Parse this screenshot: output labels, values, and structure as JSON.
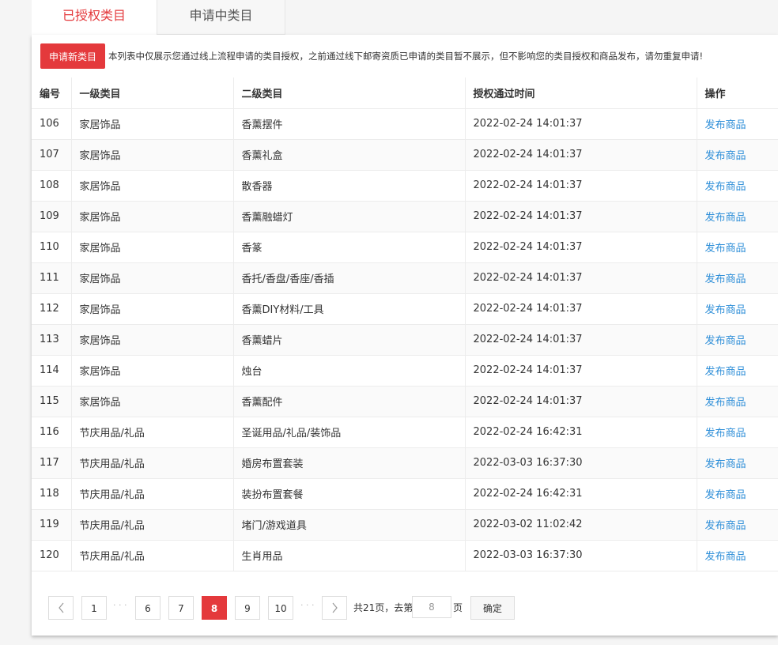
{
  "tabs": [
    {
      "label": "已授权类目"
    },
    {
      "label": "申请中类目"
    }
  ],
  "notice": {
    "button_label": "申请新类目",
    "text": "本列表中仅展示您通过线上流程申请的类目授权，之前通过线下邮寄资质已申请的类目暂不展示，但不影响您的类目授权和商品发布，请勿重复申请!"
  },
  "table": {
    "headers": [
      "编号",
      "一级类目",
      "二级类目",
      "授权通过时间",
      "操作"
    ],
    "rows": [
      {
        "id": "106",
        "cat1": "家居饰品",
        "cat2": "香薰摆件",
        "time": "2022-02-24 14:01:37",
        "action": "发布商品"
      },
      {
        "id": "107",
        "cat1": "家居饰品",
        "cat2": "香薰礼盒",
        "time": "2022-02-24 14:01:37",
        "action": "发布商品"
      },
      {
        "id": "108",
        "cat1": "家居饰品",
        "cat2": "散香器",
        "time": "2022-02-24 14:01:37",
        "action": "发布商品"
      },
      {
        "id": "109",
        "cat1": "家居饰品",
        "cat2": "香薰融蜡灯",
        "time": "2022-02-24 14:01:37",
        "action": "发布商品"
      },
      {
        "id": "110",
        "cat1": "家居饰品",
        "cat2": "香篆",
        "time": "2022-02-24 14:01:37",
        "action": "发布商品"
      },
      {
        "id": "111",
        "cat1": "家居饰品",
        "cat2": "香托/香盘/香座/香插",
        "time": "2022-02-24 14:01:37",
        "action": "发布商品"
      },
      {
        "id": "112",
        "cat1": "家居饰品",
        "cat2": "香薰DIY材料/工具",
        "time": "2022-02-24 14:01:37",
        "action": "发布商品"
      },
      {
        "id": "113",
        "cat1": "家居饰品",
        "cat2": "香薰蜡片",
        "time": "2022-02-24 14:01:37",
        "action": "发布商品"
      },
      {
        "id": "114",
        "cat1": "家居饰品",
        "cat2": "烛台",
        "time": "2022-02-24 14:01:37",
        "action": "发布商品"
      },
      {
        "id": "115",
        "cat1": "家居饰品",
        "cat2": "香薰配件",
        "time": "2022-02-24 14:01:37",
        "action": "发布商品"
      },
      {
        "id": "116",
        "cat1": "节庆用品/礼品",
        "cat2": "圣诞用品/礼品/装饰品",
        "time": "2022-02-24 16:42:31",
        "action": "发布商品"
      },
      {
        "id": "117",
        "cat1": "节庆用品/礼品",
        "cat2": "婚房布置套装",
        "time": "2022-03-03 16:37:30",
        "action": "发布商品"
      },
      {
        "id": "118",
        "cat1": "节庆用品/礼品",
        "cat2": "装扮布置套餐",
        "time": "2022-02-24 16:42:31",
        "action": "发布商品"
      },
      {
        "id": "119",
        "cat1": "节庆用品/礼品",
        "cat2": "堵门/游戏道具",
        "time": "2022-03-02 11:02:42",
        "action": "发布商品"
      },
      {
        "id": "120",
        "cat1": "节庆用品/礼品",
        "cat2": "生肖用品",
        "time": "2022-03-03 16:37:30",
        "action": "发布商品"
      }
    ]
  },
  "pager": {
    "first": "1",
    "dots": "· · ·",
    "pages": [
      "6",
      "7",
      "8",
      "9",
      "10"
    ],
    "current": "8",
    "total_text": "共21页，去第",
    "goto_value": "8",
    "page_suffix": "页",
    "confirm_label": "确定"
  },
  "colors": {
    "accent": "#e4393c",
    "link": "#2d8ed8"
  },
  "icons": {
    "prev": "chevron-left-icon",
    "next": "chevron-right-icon"
  }
}
